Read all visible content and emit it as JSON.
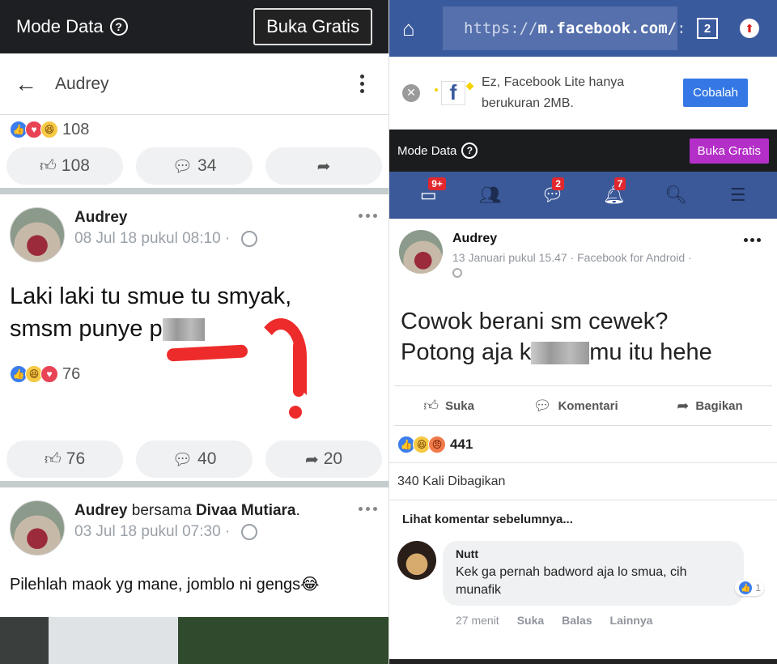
{
  "left": {
    "top_bar": {
      "mode_label": "Mode Data",
      "help_icon": "question-circle-icon",
      "open_free_label": "Buka Gratis"
    },
    "header": {
      "back_icon": "arrow-left-icon",
      "title": "Audrey",
      "menu_icon": "vertical-dots-icon"
    },
    "posts": [
      {
        "reactions": [
          "like",
          "love",
          "haha"
        ],
        "reaction_count": "108",
        "actions": {
          "like_count": "108",
          "comment_count": "34",
          "share_count": ""
        }
      },
      {
        "author": "Audrey",
        "date": "08 Jul 18 pukul 08:10",
        "privacy_icon": "globe-icon",
        "text_line1": "Laki laki tu smue tu smyak,",
        "text_line2_prefix": "smsm punye p",
        "reactions": [
          "like",
          "haha",
          "love"
        ],
        "reaction_count": "76",
        "actions": {
          "like_count": "76",
          "comment_count": "40",
          "share_count": "20"
        }
      },
      {
        "author": "Audrey",
        "with_label": "bersama",
        "tagged": "Divaa Mutiara",
        "tagged_suffix": ".",
        "date": "03 Jul 18 pukul 07:30",
        "privacy_icon": "globe-icon",
        "text": "Pilehlah maok yg mane, jomblo ni gengs",
        "text_emoji": "😂"
      }
    ]
  },
  "right": {
    "browser": {
      "home_icon": "home-icon",
      "url_scheme": "https://",
      "url_host": "m.facebook.com/",
      "url_rest": ":",
      "tab_count": "2",
      "update_icon": "arrow-up-circle-icon"
    },
    "banner": {
      "close_icon": "close-circle-icon",
      "logo_letter": "f",
      "text": "Ez, Facebook Lite hanya berukuran 2MB.",
      "cta": "Cobalah"
    },
    "data_bar": {
      "mode_label": "Mode Data",
      "open_free_label": "Buka Gratis"
    },
    "nav": [
      {
        "icon": "news-feed-icon",
        "badge": "9+"
      },
      {
        "icon": "friends-icon",
        "badge": ""
      },
      {
        "icon": "messenger-icon",
        "badge": "2"
      },
      {
        "icon": "bell-icon",
        "badge": "7"
      },
      {
        "icon": "search-icon",
        "badge": ""
      },
      {
        "icon": "menu-icon",
        "badge": ""
      }
    ],
    "post": {
      "author": "Audrey",
      "date": "13 Januari pukul 15.47 · Facebook for Android ·",
      "text_line1": "Cowok berani sm cewek?",
      "text_line2_prefix": "Potong aja k",
      "text_line2_suffix": "mu itu hehe",
      "actions": {
        "like": "Suka",
        "comment": "Komentari",
        "share": "Bagikan"
      },
      "reactions": [
        "like",
        "haha",
        "angry"
      ],
      "reaction_count": "441",
      "shares": "340 Kali Dibagikan",
      "previous_comments": "Lihat komentar sebelumnya..."
    },
    "comment": {
      "author": "Nutt",
      "text": "Kek ga pernah badword aja lo smua, cih munafik",
      "like_count": "1",
      "time": "27 menit",
      "like_label": "Suka",
      "reply_label": "Balas",
      "more_label": "Lainnya"
    }
  },
  "colors": {
    "fb_blue": "#3b5998",
    "annotation_red": "#ee2b2b",
    "buka_gratis_purple": "#b42fc8",
    "cta_blue": "#3578e5"
  }
}
